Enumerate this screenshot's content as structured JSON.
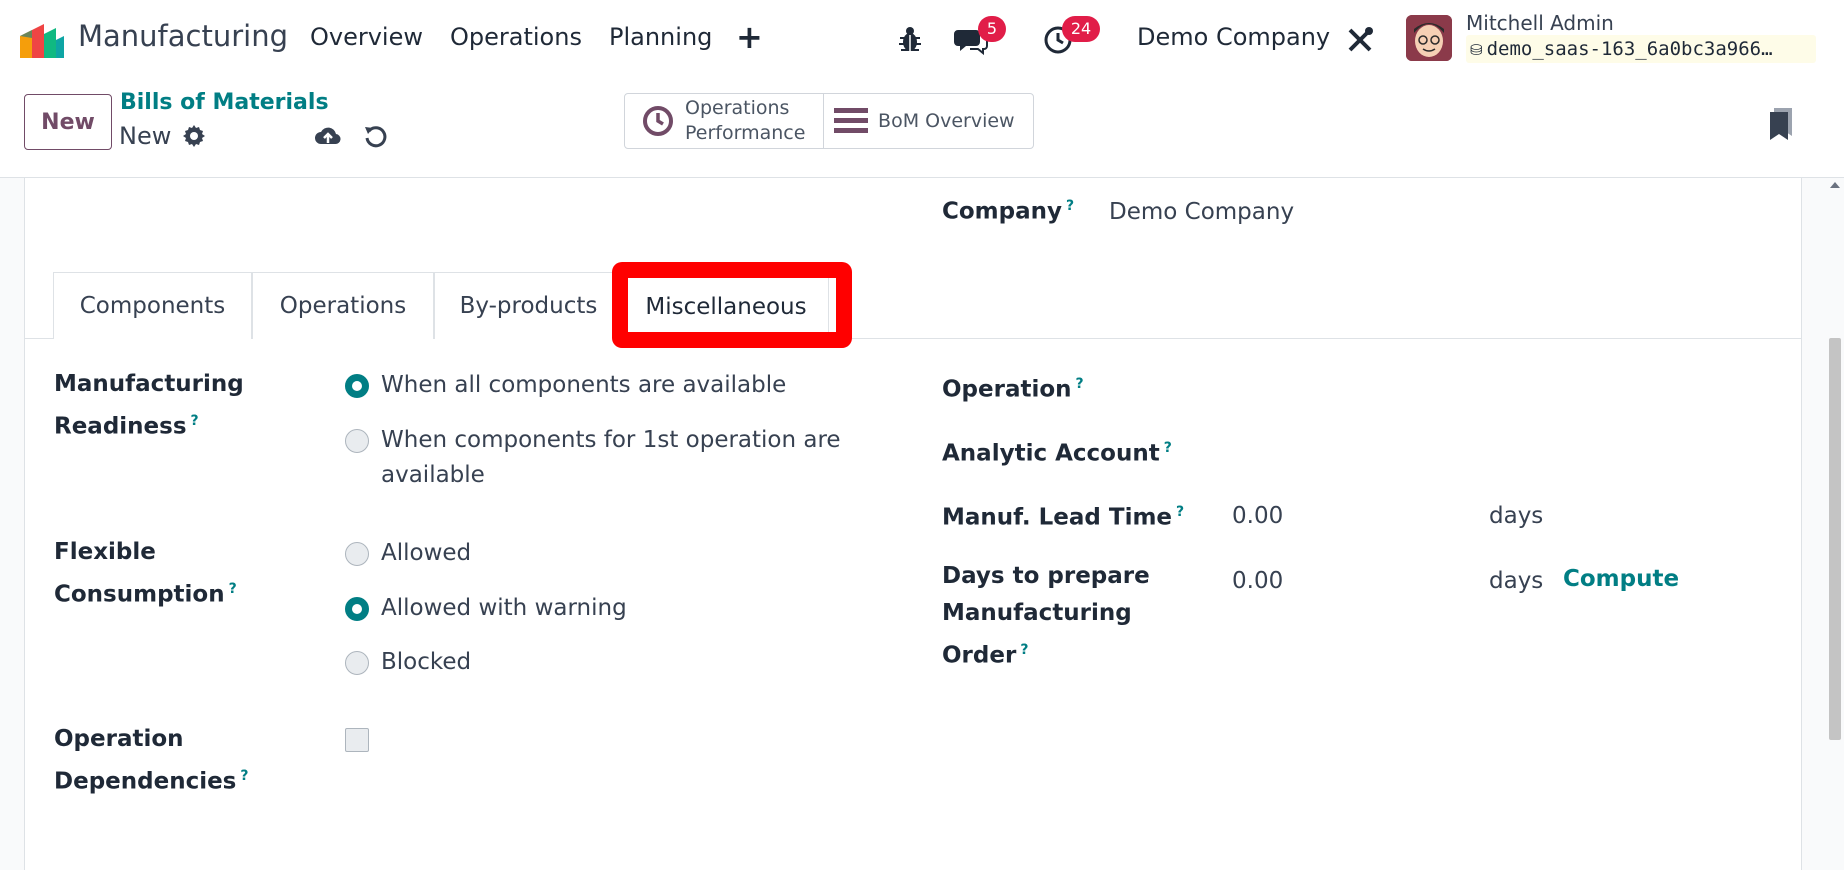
{
  "navbar": {
    "app_name": "Manufacturing",
    "menus": [
      "Overview",
      "Operations",
      "Planning"
    ],
    "plus_icon": "+",
    "messages_badge": "5",
    "activities_badge": "24",
    "company": "Demo Company",
    "user_name": "Mitchell Admin",
    "db_name": "demo_saas-163_6a0bc3a966…"
  },
  "control_panel": {
    "new_button": "New",
    "breadcrumb": "Bills of Materials",
    "record_name": "New",
    "smart_buttons": {
      "performance_line1": "Operations",
      "performance_line2": "Performance",
      "bom_overview": "BoM Overview"
    }
  },
  "form": {
    "company_label": "Company",
    "company_value": "Demo Company",
    "tabs": [
      "Components",
      "Operations",
      "By-products",
      "Miscellaneous"
    ],
    "active_tab": "Miscellaneous",
    "readiness": {
      "label_line1": "Manufacturing",
      "label_line2": "Readiness",
      "options": [
        "When all components are available",
        "When components for 1st operation are",
        "available"
      ],
      "selected": "When all components are available"
    },
    "consumption": {
      "label_line1": "Flexible",
      "label_line2": "Consumption",
      "options": [
        "Allowed",
        "Allowed with warning",
        "Blocked"
      ],
      "selected": "Allowed with warning"
    },
    "dependencies": {
      "label_line1": "Operation",
      "label_line2": "Dependencies",
      "checked": false
    },
    "operation_label": "Operation",
    "analytic_label": "Analytic Account",
    "lead_time": {
      "label": "Manuf. Lead Time",
      "value": "0.00",
      "unit": "days"
    },
    "days_prepare": {
      "label_line1": "Days to prepare",
      "label_line2": "Manufacturing",
      "label_line3": "Order",
      "value": "0.00",
      "unit": "days",
      "compute": "Compute"
    },
    "help_marker": "?"
  },
  "colors": {
    "brand": "#714b67",
    "accent": "#017e84",
    "badge": "#e11d48",
    "highlight": "#ff0000"
  },
  "icons": [
    "app-logo-icon",
    "bug-icon",
    "chat-icon",
    "clock-icon",
    "tools-icon",
    "database-icon",
    "gear-icon",
    "cloud-upload-icon",
    "undo-icon",
    "clock-history-icon",
    "bars-icon",
    "bookmark-icon"
  ]
}
